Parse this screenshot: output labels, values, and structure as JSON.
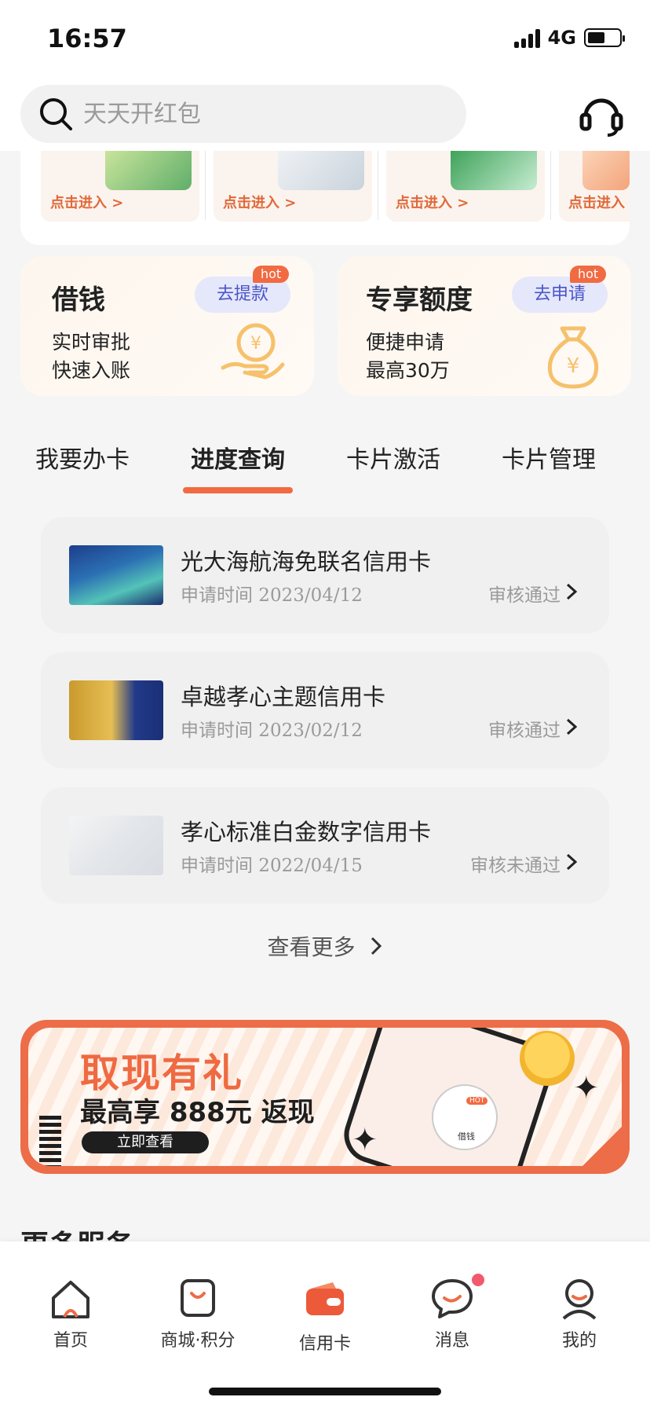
{
  "status_bar": {
    "time": "16:57",
    "network": "4G"
  },
  "search": {
    "placeholder": "天天开红包"
  },
  "card_strip": {
    "items": [
      {
        "enter": "点击进入 >"
      },
      {
        "enter": "点击进入 >"
      },
      {
        "enter": "点击进入 >"
      },
      {
        "enter": "点击进入 >"
      }
    ]
  },
  "promos": [
    {
      "title": "借钱",
      "lines": [
        "实时审批",
        "快速入账"
      ],
      "button": "去提款",
      "badge": "hot"
    },
    {
      "title": "专享额度",
      "lines": [
        "便捷申请",
        "最高30万"
      ],
      "button": "去申请",
      "badge": "hot"
    }
  ],
  "tabs": [
    {
      "label": "我要办卡"
    },
    {
      "label": "进度查询"
    },
    {
      "label": "卡片激活"
    },
    {
      "label": "卡片管理"
    }
  ],
  "active_tab": "进度查询",
  "applications": [
    {
      "name": "光大海航海免联名信用卡",
      "date": "申请时间 2023/04/12",
      "status": "审核通过"
    },
    {
      "name": "卓越孝心主题信用卡",
      "date": "申请时间 2023/02/12",
      "status": "审核通过"
    },
    {
      "name": "孝心标准白金数字信用卡",
      "date": "申请时间 2022/04/15",
      "status": "审核未通过"
    }
  ],
  "see_more": "查看更多",
  "banner": {
    "title": "取现有礼",
    "subtitle": "最高享 888元 返现",
    "cta": "立即查看",
    "phone_label": "借钱",
    "phone_badge": "HOT"
  },
  "more_services": "更多服务",
  "tabbar": [
    {
      "label": "首页",
      "icon": "home-icon"
    },
    {
      "label": "商城·积分",
      "icon": "shopping-bag-icon"
    },
    {
      "label": "信用卡",
      "icon": "credit-card-wallet-icon"
    },
    {
      "label": "消息",
      "icon": "message-icon"
    },
    {
      "label": "我的",
      "icon": "profile-icon"
    }
  ],
  "colors": {
    "accent": "#f26a42",
    "pill_bg": "#e5e7fb",
    "pill_text": "#4a55c6",
    "banner": "#ec6d48"
  }
}
